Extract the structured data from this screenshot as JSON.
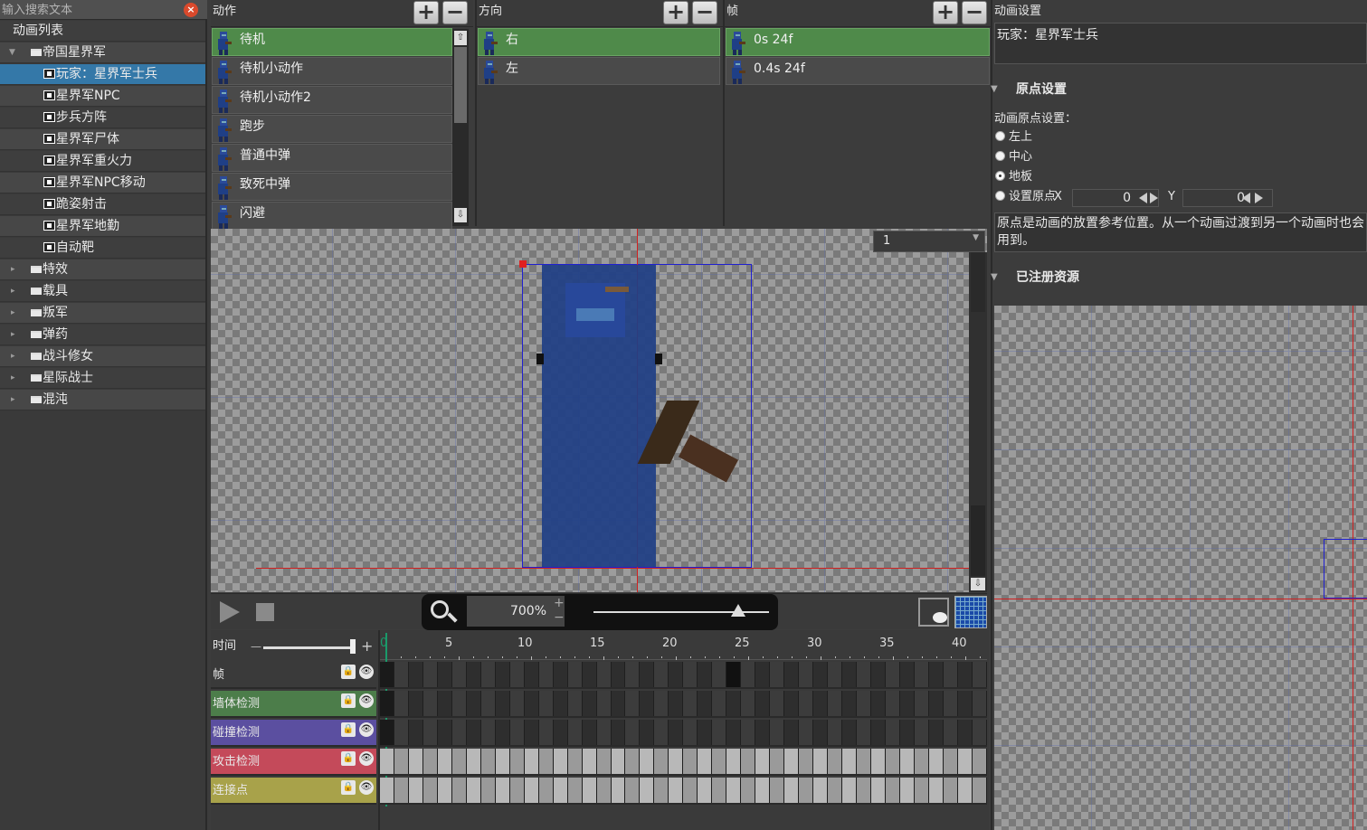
{
  "search": {
    "placeholder": "输入搜索文本"
  },
  "tree": {
    "root_label": "动画列表",
    "group_label": "帝国星界军",
    "items": [
      "玩家：星界军士兵",
      "星界军NPC",
      "步兵方阵",
      "星界军尸体",
      "星界军重火力",
      "星界军NPC移动",
      "跪姿射击",
      "星界军地勤",
      "自动靶"
    ],
    "folders": [
      "特效",
      "载具",
      "叛军",
      "弹药",
      "战斗修女",
      "星际战士",
      "混沌"
    ]
  },
  "actions": {
    "title": "动作",
    "items": [
      "待机",
      "待机小动作",
      "待机小动作2",
      "跑步",
      "普通中弹",
      "致死中弹",
      "闪避"
    ]
  },
  "directions": {
    "title": "方向",
    "items": [
      "右",
      "左"
    ]
  },
  "frames": {
    "title": "帧",
    "items": [
      "0s 24f",
      "0.4s 24f"
    ]
  },
  "viewer": {
    "frame_select": "1",
    "zoom": "700%"
  },
  "timeline": {
    "time_label": "时间",
    "ticks": [
      "0",
      "5",
      "10",
      "15",
      "20",
      "25",
      "30",
      "35",
      "40"
    ],
    "tracks": [
      {
        "label": "帧",
        "color": "#3a3a3a"
      },
      {
        "label": "墙体检测",
        "color": "#4c7d4a"
      },
      {
        "label": "碰撞检测",
        "color": "#5b4fa0"
      },
      {
        "label": "攻击检测",
        "color": "#c44a5a"
      },
      {
        "label": "连接点",
        "color": "#a8a24a"
      }
    ],
    "lock_glyph": "🔒",
    "eye_glyph": "👁"
  },
  "settings": {
    "panel_title": "动画设置",
    "anim_name": "玩家：星界军士兵",
    "origin_section": "原点设置",
    "origin_label": "动画原点设置：",
    "options": [
      "左上",
      "中心",
      "地板",
      "设置原点"
    ],
    "selected_option": "地板",
    "x_label": "X",
    "y_label": "Y",
    "x_value": "0",
    "y_value": "0",
    "help": "原点是动画的放置参考位置。从一个动画过渡到另一个动画时也会用到。",
    "assets_section": "已注册资源"
  }
}
